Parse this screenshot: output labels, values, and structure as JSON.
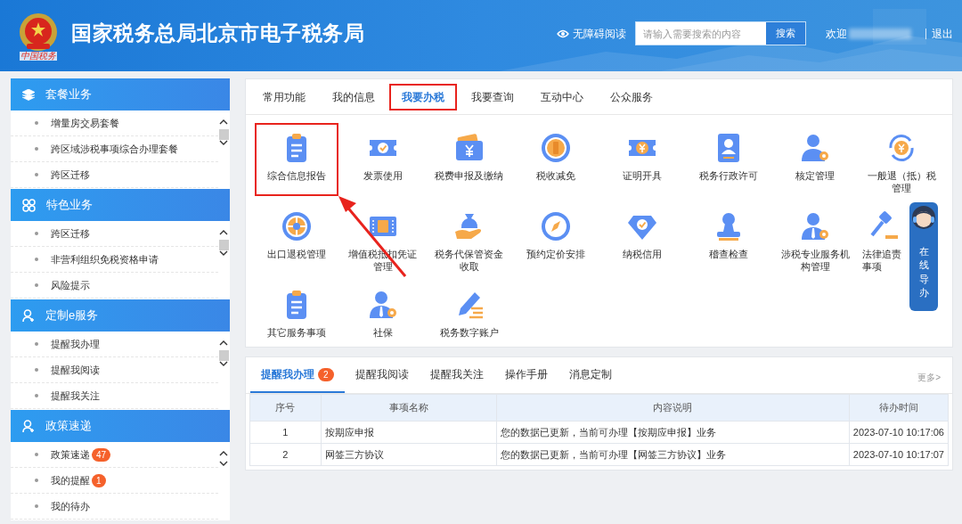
{
  "header": {
    "title": "国家税务总局北京市电子税务局",
    "logo_caption": "中国税务",
    "accessibility": "无障碍阅读",
    "search": {
      "placeholder": "请输入需要搜索的内容",
      "button": "搜索"
    },
    "welcome": "欢迎",
    "logout": "退出"
  },
  "sidebar": [
    {
      "title": "套餐业务",
      "items": [
        {
          "label": "增量房交易套餐"
        },
        {
          "label": "跨区域涉税事项综合办理套餐"
        },
        {
          "label": "跨区迁移"
        }
      ]
    },
    {
      "title": "特色业务",
      "items": [
        {
          "label": "跨区迁移"
        },
        {
          "label": "非营利组织免税资格申请"
        },
        {
          "label": "风险提示"
        }
      ]
    },
    {
      "title": "定制e服务",
      "items": [
        {
          "label": "提醒我办理"
        },
        {
          "label": "提醒我阅读"
        },
        {
          "label": "提醒我关注"
        }
      ]
    },
    {
      "title": "政策速递",
      "items": [
        {
          "label": "政策速递",
          "badge": "47"
        },
        {
          "label": "我的提醒",
          "badge": "1"
        },
        {
          "label": "我的待办"
        }
      ]
    }
  ],
  "service_tabs": [
    {
      "label": "常用功能",
      "selected": false,
      "highlighted": false
    },
    {
      "label": "我的信息",
      "selected": false,
      "highlighted": false
    },
    {
      "label": "我要办税",
      "selected": true,
      "highlighted": true
    },
    {
      "label": "我要查询",
      "selected": false,
      "highlighted": false
    },
    {
      "label": "互动中心",
      "selected": false,
      "highlighted": false
    },
    {
      "label": "公众服务",
      "selected": false,
      "highlighted": false
    }
  ],
  "services": [
    {
      "label": "综合信息报告",
      "highlighted": true
    },
    {
      "label": "发票使用",
      "highlighted": false
    },
    {
      "label": "税费申报及缴纳",
      "highlighted": false
    },
    {
      "label": "税收减免",
      "highlighted": false
    },
    {
      "label": "证明开具",
      "highlighted": false
    },
    {
      "label": "税务行政许可",
      "highlighted": false
    },
    {
      "label": "核定管理",
      "highlighted": false
    },
    {
      "label": "一般退（抵）税管理",
      "highlighted": false
    },
    {
      "label": "出口退税管理",
      "highlighted": false
    },
    {
      "label": "增值税抵扣凭证管理",
      "highlighted": false
    },
    {
      "label": "税务代保管资金收取",
      "highlighted": false
    },
    {
      "label": "预约定价安排",
      "highlighted": false
    },
    {
      "label": "纳税信用",
      "highlighted": false
    },
    {
      "label": "稽查检查",
      "highlighted": false
    },
    {
      "label": "涉税专业服务机构管理",
      "highlighted": false
    },
    {
      "label": "法律追责事项",
      "highlighted": false
    },
    {
      "label": "其它服务事项",
      "highlighted": false
    },
    {
      "label": "社保",
      "highlighted": false
    },
    {
      "label": "税务数字账户",
      "highlighted": false
    }
  ],
  "online_guide": "在线导办",
  "reminders": {
    "tabs": [
      {
        "label": "提醒我办理",
        "badge": "2",
        "selected": true
      },
      {
        "label": "提醒我阅读",
        "selected": false
      },
      {
        "label": "提醒我关注",
        "selected": false
      },
      {
        "label": "操作手册",
        "selected": false
      },
      {
        "label": "消息定制",
        "selected": false
      }
    ],
    "more": "更多>",
    "columns": [
      "序号",
      "事项名称",
      "内容说明",
      "待办时间"
    ],
    "rows": [
      [
        "1",
        "按期应申报",
        "您的数据已更新，当前可办理【按期应申报】业务",
        "2023-07-10 10:17:06"
      ],
      [
        "2",
        "网签三方协议",
        "您的数据已更新，当前可办理【网签三方协议】业务",
        "2023-07-10 10:17:07"
      ]
    ]
  }
}
